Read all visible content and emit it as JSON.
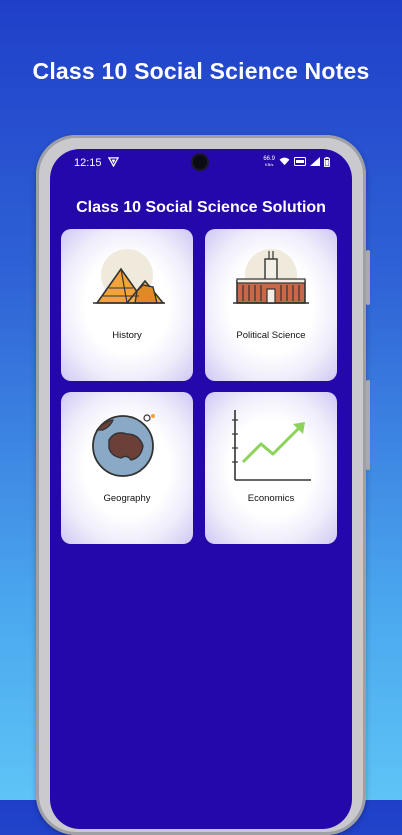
{
  "promo": {
    "title": "Class 10 Social Science Notes"
  },
  "status_bar": {
    "time": "12:15",
    "net_speed_value": "66.9",
    "net_speed_unit": "KB/s",
    "icons": [
      "vpn-logo-icon",
      "wifi-icon",
      "volte-icon",
      "signal-icon",
      "battery-icon"
    ]
  },
  "app": {
    "title": "Class 10 Social Science Solution",
    "background_color": "#2408a9",
    "subjects": [
      {
        "label": "History",
        "icon": "pyramids-icon"
      },
      {
        "label": "Political Science",
        "icon": "parliament-icon"
      },
      {
        "label": "Geography",
        "icon": "globe-icon"
      },
      {
        "label": "Economics",
        "icon": "growth-chart-icon"
      }
    ]
  }
}
